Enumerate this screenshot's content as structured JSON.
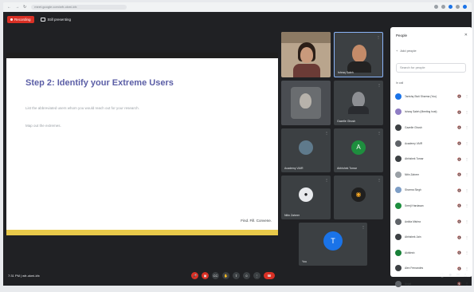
{
  "browser": {
    "url": "meet.google.com/wfr-okmi-kfx"
  },
  "meeting": {
    "recording_label": "Recording",
    "presenting_label": "Still presenting",
    "info": "7:31 PM | wfr-okmi-kfx"
  },
  "slide": {
    "title": "Step 2: Identify your Extreme Users",
    "line1": "List the abbreviated users whom you would reach out for your research.",
    "line2": "Map out the extremes.",
    "footer": "Find. Fill. Convene."
  },
  "tiles": [
    {
      "name": "",
      "mic": ""
    },
    {
      "name": "Ishraq Saleh",
      "mic": "⋮"
    },
    {
      "name": "",
      "mic": ""
    },
    {
      "name": "Gazelle Ghosh",
      "mic": "⋮"
    },
    {
      "name": "Academy VAIR",
      "mic": "⋮",
      "initial": ""
    },
    {
      "name": "Abhishek Tomar",
      "mic": "⋮",
      "initial": "A"
    },
    {
      "name": "Nitin Zaheer",
      "mic": "⋮"
    },
    {
      "name": "",
      "mic": "⋮"
    },
    {
      "name": "You",
      "mic": "⋮",
      "initial": "T"
    }
  ],
  "people": {
    "title": "People",
    "add_label": "Add people",
    "search_placeholder": "Search for people",
    "section_label": "In call",
    "list": [
      {
        "name": "Tanishq Stuti Sharma (You)",
        "color": "#1a73e8"
      },
      {
        "name": "Ishraq Saleh (Meeting host)",
        "color": "#8e7cc3"
      },
      {
        "name": "Gazelle Ghosh",
        "color": "#3c4043"
      },
      {
        "name": "Academy VAIR",
        "color": "#5f6368"
      },
      {
        "name": "Abhishek Tomar",
        "color": "#3c4043"
      },
      {
        "name": "Nitin Zaheer",
        "color": "#9aa0a6"
      },
      {
        "name": "Sharma Singh",
        "color": "#7e9ec6"
      },
      {
        "name": "Sreeji Hardasan",
        "color": "#1e8e3e"
      },
      {
        "name": "Ankita Mishra",
        "color": "#5f6368"
      },
      {
        "name": "Abhishek Jain",
        "color": "#3c4043"
      },
      {
        "name": "Akhilesh",
        "color": "#188038"
      },
      {
        "name": "Alex Fernandes",
        "color": "#3c4043"
      },
      {
        "name": "Anjali",
        "color": "#5f6368"
      }
    ]
  }
}
